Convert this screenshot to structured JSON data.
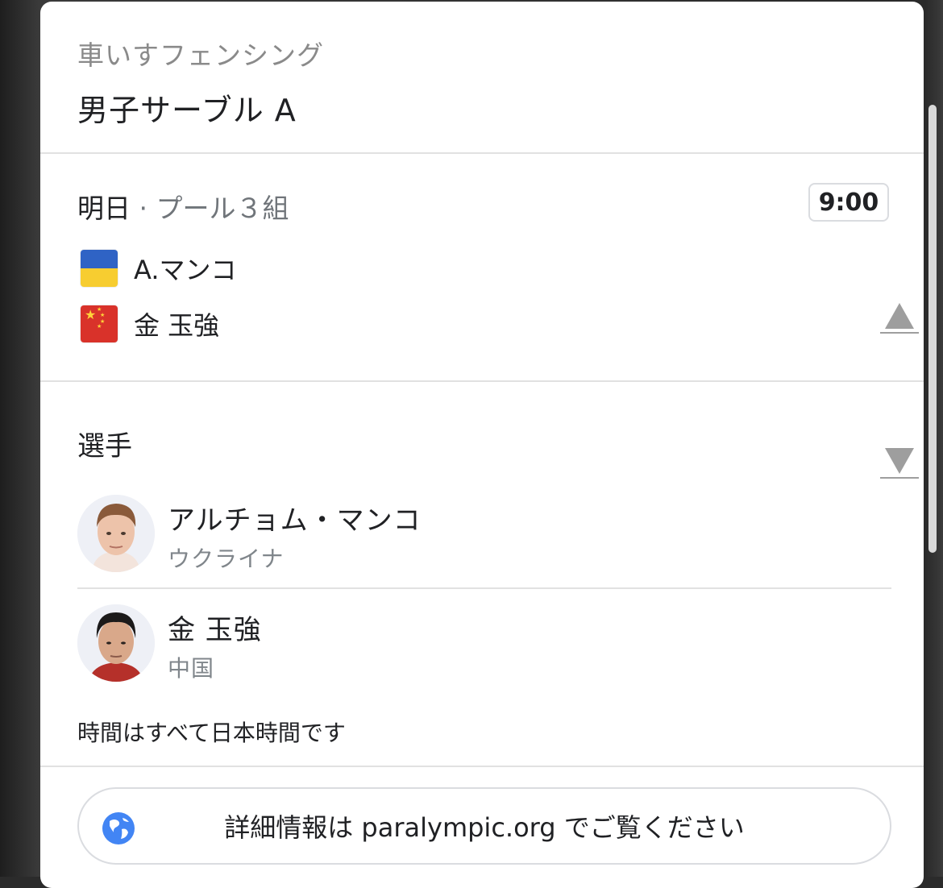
{
  "header": {
    "sport": "車いすフェンシング",
    "event": "男子サーブル A"
  },
  "match": {
    "day": "明日",
    "separator": " · ",
    "pool": "プール３組",
    "time": "9:00",
    "competitors": [
      {
        "name": "A.マンコ",
        "flag": "ukraine-flag-icon"
      },
      {
        "name": "金 玉強",
        "flag": "china-flag-icon"
      }
    ]
  },
  "athletes_section": {
    "title": "選手",
    "athletes": [
      {
        "name": "アルチョム・マンコ",
        "country": "ウクライナ"
      },
      {
        "name": "金 玉強",
        "country": "中国"
      }
    ]
  },
  "note": "時間はすべて日本時間です",
  "link": {
    "label": "詳細情報は paralympic.org でご覧ください",
    "icon": "globe-icon"
  },
  "colors": {
    "ukraine_blue": "#2f63c5",
    "ukraine_yellow": "#f7cd30",
    "china_red": "#d9322a",
    "globe_blue": "#4285f4"
  }
}
